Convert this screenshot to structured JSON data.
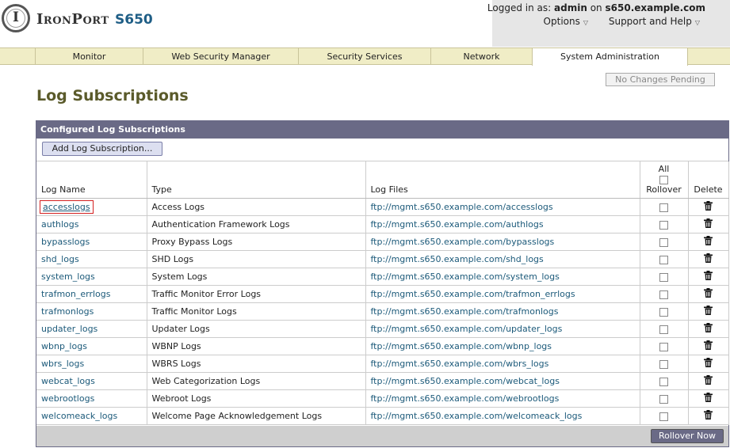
{
  "header": {
    "brand": "IronPort",
    "model": "S650",
    "logo_letter": "I",
    "logged_in_label": "Logged in as:",
    "user": "admin",
    "on_label": "on",
    "host": "s650.example.com",
    "menus": [
      "Options",
      "Support and Help"
    ]
  },
  "nav": {
    "tabs": [
      "Monitor",
      "Web Security Manager",
      "Security Services",
      "Network",
      "System Administration"
    ],
    "active": "System Administration"
  },
  "pending_label": "No Changes Pending",
  "page_title": "Log Subscriptions",
  "panel": {
    "title": "Configured Log Subscriptions",
    "add_button": "Add Log Subscription...",
    "columns": {
      "name": "Log Name",
      "type": "Type",
      "files": "Log Files",
      "all": "All",
      "rollover": "Rollover",
      "delete": "Delete"
    },
    "rows": [
      {
        "name": "accesslogs",
        "type": "Access Logs",
        "file": "ftp://mgmt.s650.example.com/accesslogs"
      },
      {
        "name": "authlogs",
        "type": "Authentication Framework Logs",
        "file": "ftp://mgmt.s650.example.com/authlogs"
      },
      {
        "name": "bypasslogs",
        "type": "Proxy Bypass Logs",
        "file": "ftp://mgmt.s650.example.com/bypasslogs"
      },
      {
        "name": "shd_logs",
        "type": "SHD Logs",
        "file": "ftp://mgmt.s650.example.com/shd_logs"
      },
      {
        "name": "system_logs",
        "type": "System Logs",
        "file": "ftp://mgmt.s650.example.com/system_logs"
      },
      {
        "name": "trafmon_errlogs",
        "type": "Traffic Monitor Error Logs",
        "file": "ftp://mgmt.s650.example.com/trafmon_errlogs"
      },
      {
        "name": "trafmonlogs",
        "type": "Traffic Monitor Logs",
        "file": "ftp://mgmt.s650.example.com/trafmonlogs"
      },
      {
        "name": "updater_logs",
        "type": "Updater Logs",
        "file": "ftp://mgmt.s650.example.com/updater_logs"
      },
      {
        "name": "wbnp_logs",
        "type": "WBNP Logs",
        "file": "ftp://mgmt.s650.example.com/wbnp_logs"
      },
      {
        "name": "wbrs_logs",
        "type": "WBRS Logs",
        "file": "ftp://mgmt.s650.example.com/wbrs_logs"
      },
      {
        "name": "webcat_logs",
        "type": "Web Categorization Logs",
        "file": "ftp://mgmt.s650.example.com/webcat_logs"
      },
      {
        "name": "webrootlogs",
        "type": "Webroot Logs",
        "file": "ftp://mgmt.s650.example.com/webrootlogs"
      },
      {
        "name": "welcomeack_logs",
        "type": "Welcome Page Acknowledgement Logs",
        "file": "ftp://mgmt.s650.example.com/welcomeack_logs"
      }
    ],
    "selected_row": "accesslogs",
    "rollover_button": "Rollover Now"
  },
  "colors": {
    "panel_header": "#6a6a86",
    "nav_bar": "#f0edc6",
    "title": "#5a5a2a",
    "link": "#1c5a7a",
    "brand_model": "#1f5e86"
  },
  "icons": {
    "row_delete": "trash-icon",
    "menu_caret": "chevron-down-icon"
  }
}
